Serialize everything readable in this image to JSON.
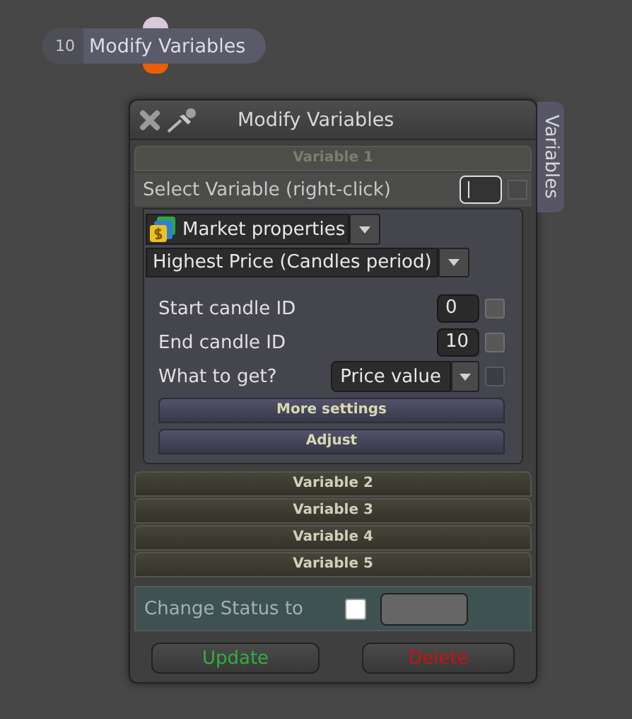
{
  "node": {
    "number": "10",
    "title": "Modify Variables"
  },
  "window": {
    "title": "Modify Variables",
    "side_tab": "Variables"
  },
  "variables": [
    {
      "title": "Variable 1",
      "expanded": true,
      "select_label": "Select Variable (right-click)",
      "select_checked": false,
      "source": "Market properties",
      "property": "Highest Price (Candles period)",
      "params": [
        {
          "kind": "number",
          "label": "Start candle ID",
          "value": "0",
          "checked": false
        },
        {
          "kind": "number",
          "label": "End candle ID",
          "value": "10",
          "checked": false
        },
        {
          "kind": "dropdown",
          "label": "What to get?",
          "value": "Price value",
          "checked": false
        }
      ],
      "actions": [
        "More settings",
        "Adjust"
      ]
    },
    {
      "title": "Variable 2",
      "expanded": false
    },
    {
      "title": "Variable 3",
      "expanded": false
    },
    {
      "title": "Variable 4",
      "expanded": false
    },
    {
      "title": "Variable 5",
      "expanded": false
    }
  ],
  "status": {
    "label": "Change Status to",
    "checked": false
  },
  "buttons": [
    {
      "kind": "update",
      "label": "Update"
    },
    {
      "kind": "delete",
      "label": "Delete"
    }
  ]
}
